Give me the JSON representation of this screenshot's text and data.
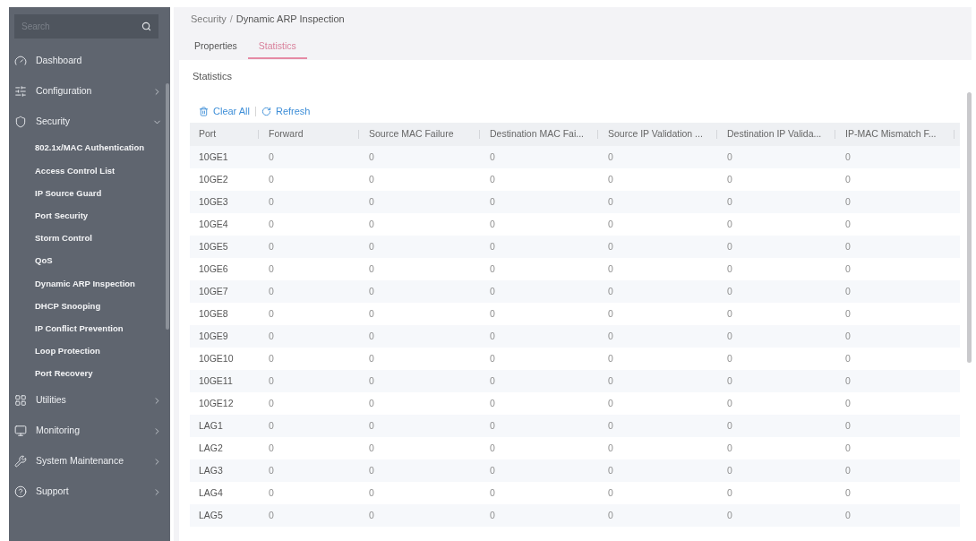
{
  "sidebar": {
    "search": {
      "placeholder": "Search"
    },
    "items": [
      {
        "kind": "link",
        "label": "Dashboard"
      },
      {
        "kind": "group",
        "label": "Configuration",
        "expanded": false
      },
      {
        "kind": "group",
        "label": "Security",
        "expanded": true,
        "children": [
          {
            "label": "802.1x/MAC Authentication"
          },
          {
            "label": "Access Control List"
          },
          {
            "label": "IP Source Guard"
          },
          {
            "label": "Port Security"
          },
          {
            "label": "Storm Control"
          },
          {
            "label": "QoS"
          },
          {
            "label": "Dynamic ARP Inspection"
          },
          {
            "label": "DHCP Snooping"
          },
          {
            "label": "IP Conflict Prevention"
          },
          {
            "label": "Loop Protection"
          },
          {
            "label": "Port Recovery"
          }
        ]
      },
      {
        "kind": "group",
        "label": "Utilities",
        "expanded": false
      },
      {
        "kind": "group",
        "label": "Monitoring",
        "expanded": false
      },
      {
        "kind": "group",
        "label": "System Maintenance",
        "expanded": false
      },
      {
        "kind": "group",
        "label": "Support",
        "expanded": false
      }
    ]
  },
  "breadcrumb": {
    "items": [
      "Security",
      "Dynamic ARP Inspection"
    ],
    "separator": "/"
  },
  "tabs": [
    {
      "label": "Properties",
      "selected": false
    },
    {
      "label": "Statistics",
      "selected": true
    }
  ],
  "panel": {
    "title": "Statistics",
    "toolbar": [
      {
        "label": "Clear All"
      },
      {
        "label": "Refresh"
      }
    ],
    "table": {
      "columns": [
        "Port",
        "Forward",
        "Source MAC Failure",
        "Destination MAC Fai...",
        "Source IP Validation ...",
        "Destination IP Valida...",
        "IP-MAC Mismatch F..."
      ],
      "rows": [
        [
          "10GE1",
          "0",
          "0",
          "0",
          "0",
          "0",
          "0"
        ],
        [
          "10GE2",
          "0",
          "0",
          "0",
          "0",
          "0",
          "0"
        ],
        [
          "10GE3",
          "0",
          "0",
          "0",
          "0",
          "0",
          "0"
        ],
        [
          "10GE4",
          "0",
          "0",
          "0",
          "0",
          "0",
          "0"
        ],
        [
          "10GE5",
          "0",
          "0",
          "0",
          "0",
          "0",
          "0"
        ],
        [
          "10GE6",
          "0",
          "0",
          "0",
          "0",
          "0",
          "0"
        ],
        [
          "10GE7",
          "0",
          "0",
          "0",
          "0",
          "0",
          "0"
        ],
        [
          "10GE8",
          "0",
          "0",
          "0",
          "0",
          "0",
          "0"
        ],
        [
          "10GE9",
          "0",
          "0",
          "0",
          "0",
          "0",
          "0"
        ],
        [
          "10GE10",
          "0",
          "0",
          "0",
          "0",
          "0",
          "0"
        ],
        [
          "10GE11",
          "0",
          "0",
          "0",
          "0",
          "0",
          "0"
        ],
        [
          "10GE12",
          "0",
          "0",
          "0",
          "0",
          "0",
          "0"
        ],
        [
          "LAG1",
          "0",
          "0",
          "0",
          "0",
          "0",
          "0"
        ],
        [
          "LAG2",
          "0",
          "0",
          "0",
          "0",
          "0",
          "0"
        ],
        [
          "LAG3",
          "0",
          "0",
          "0",
          "0",
          "0",
          "0"
        ],
        [
          "LAG4",
          "0",
          "0",
          "0",
          "0",
          "0",
          "0"
        ],
        [
          "LAG5",
          "0",
          "0",
          "0",
          "0",
          "0",
          "0"
        ]
      ]
    }
  }
}
